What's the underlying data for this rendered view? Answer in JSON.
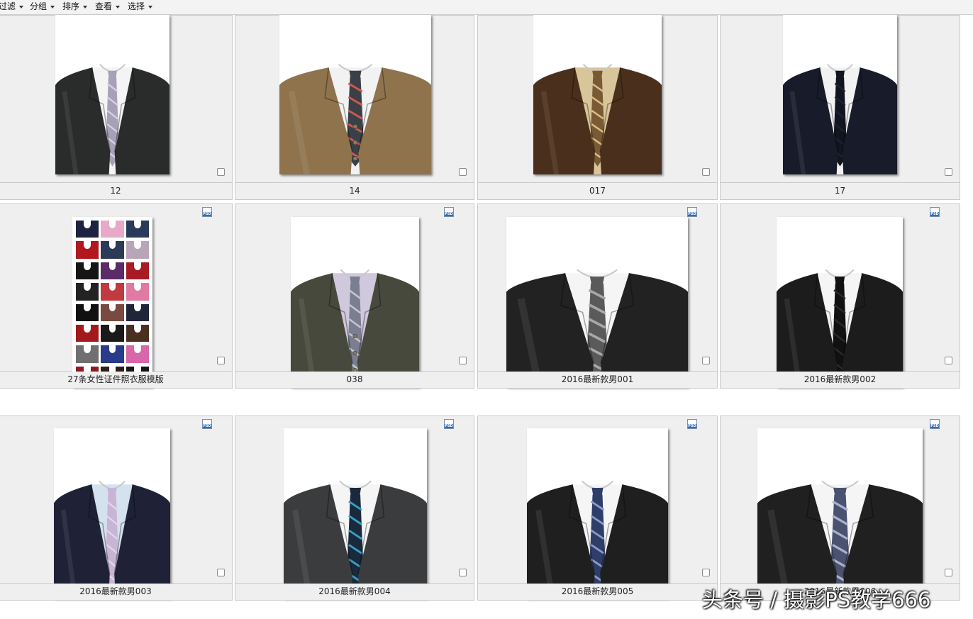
{
  "toolbar": {
    "menus": [
      {
        "label": "过滤"
      },
      {
        "label": "分组"
      },
      {
        "label": "排序"
      },
      {
        "label": "查看"
      },
      {
        "label": "选择"
      }
    ]
  },
  "files": [
    {
      "name": "12",
      "filetype": "",
      "jacket": "#2a2c2b",
      "shirt": "#f4f4f4",
      "tie": "#a8a0b6",
      "tie_stripe": "#d8d4e0",
      "buttons": false
    },
    {
      "name": "14",
      "filetype": "",
      "jacket": "#8e734d",
      "shirt": "#f2f2f2",
      "tie": "#3a4048",
      "tie_stripe": "#d2564e",
      "buttons": true
    },
    {
      "name": "017",
      "filetype": "",
      "jacket": "#4a301c",
      "shirt": "#d9c59a",
      "tie": "#7a5a34",
      "tie_stripe": "#d8bf88",
      "buttons": false
    },
    {
      "name": "17",
      "filetype": "",
      "jacket": "#181b2a",
      "shirt": "#f2f2f2",
      "tie": "#121520",
      "tie_stripe": "#1e2233",
      "buttons": false
    },
    {
      "name": "27条女性证件照衣服模版",
      "filetype": "PSD",
      "jacket": "#333",
      "shirt": "#fff",
      "tie": "#333",
      "tie_stripe": "#333",
      "buttons": false
    },
    {
      "name": "038",
      "filetype": "PSD",
      "jacket": "#47493d",
      "shirt": "#d0c8dc",
      "tie": "#7a7e90",
      "tie_stripe": "#c4c6d0",
      "buttons": true
    },
    {
      "name": "2016最新款男001",
      "filetype": "PSD",
      "jacket": "#222222",
      "shirt": "#f5f5f5",
      "tie": "#5a5a5a",
      "tie_stripe": "#a8a8a8",
      "buttons": false
    },
    {
      "name": "2016最新款男002",
      "filetype": "PSD",
      "jacket": "#1c1c1c",
      "shirt": "#f5f5f5",
      "tie": "#111111",
      "tie_stripe": "#2a2a2a",
      "buttons": false
    },
    {
      "name": "2016最新款男003",
      "filetype": "PSD",
      "jacket": "#1f2236",
      "shirt": "#d4e2f0",
      "tie": "#c8b4d4",
      "tie_stripe": "#e4d6ea",
      "buttons": false
    },
    {
      "name": "2016最新款男004",
      "filetype": "PSD",
      "jacket": "#3a3c3e",
      "shirt": "#f5f5f5",
      "tie": "#1a2a3c",
      "tie_stripe": "#34a2c8",
      "buttons": false
    },
    {
      "name": "2016最新款男005",
      "filetype": "PSD",
      "jacket": "#1f1f1f",
      "shirt": "#f5f5f5",
      "tie": "#2f3e68",
      "tie_stripe": "#8b9cc8",
      "buttons": false
    },
    {
      "name": "2016最新款男006",
      "filetype": "PSD",
      "jacket": "#202020",
      "shirt": "#f5f5f5",
      "tie": "#4a5270",
      "tie_stripe": "#a8b0cc",
      "buttons": false
    }
  ],
  "women_palette": [
    "#1d2340",
    "#e8a8c8",
    "#2a3a5a",
    "#b0171e",
    "#2c3a58",
    "#b8a6b8",
    "#151515",
    "#5a2a6a",
    "#a81b25",
    "#222",
    "#c03a40",
    "#e07aa2",
    "#111",
    "#7a4a40",
    "#20253a",
    "#a31a1e",
    "#1a1a1a",
    "#4a3020",
    "#707070",
    "#283c8a",
    "#d866a8",
    "#8e1a22",
    "#2a1f1a",
    "#151515"
  ],
  "watermark": "头条号 / 摄影PS教学666"
}
